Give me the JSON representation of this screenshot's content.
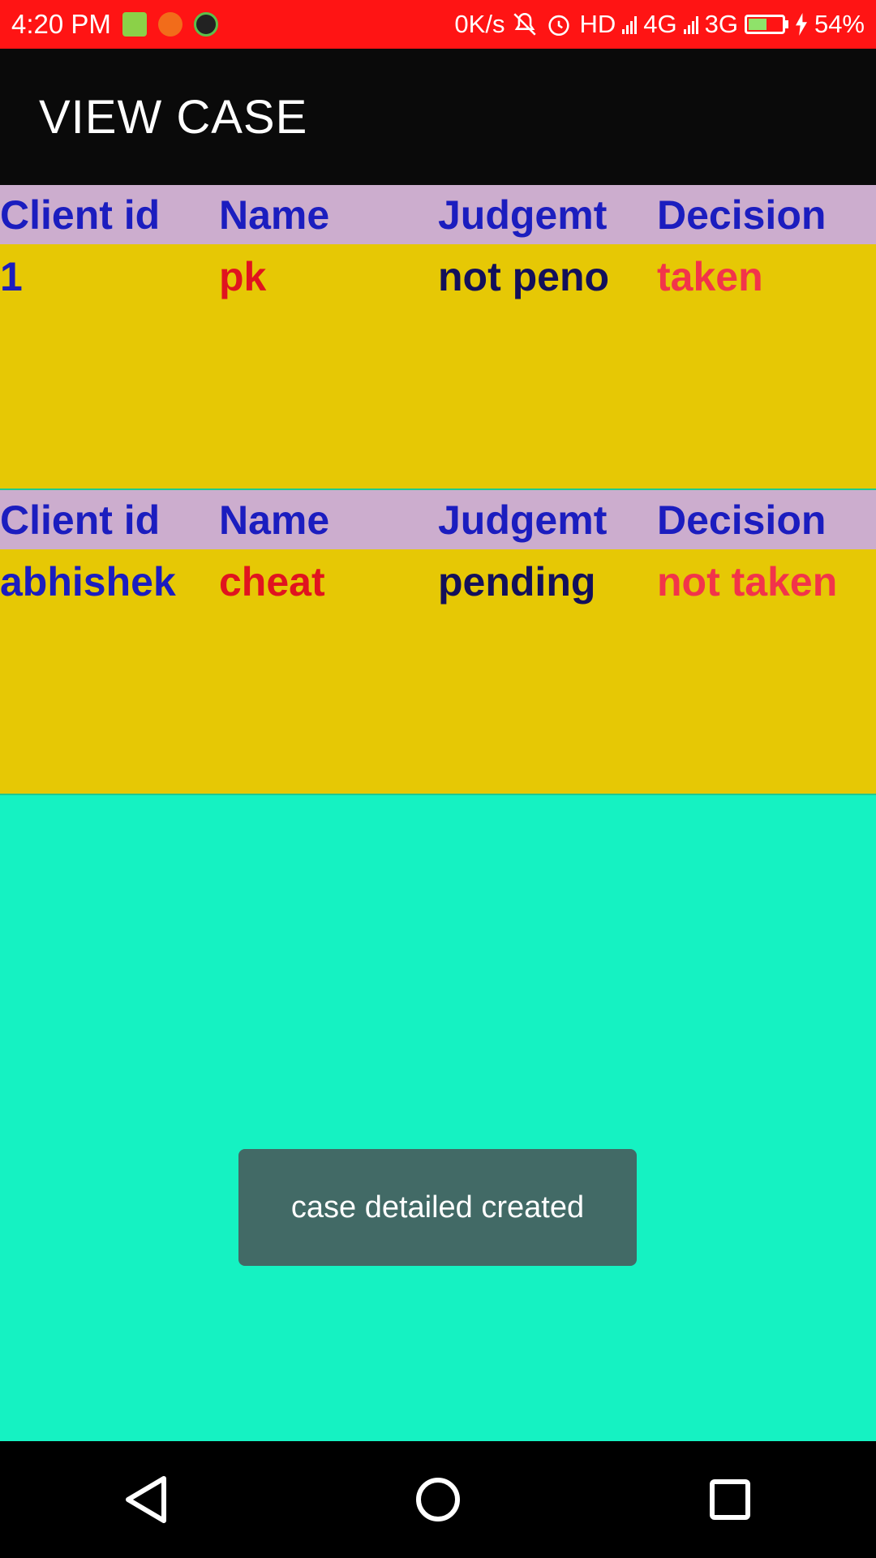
{
  "status_bar": {
    "time": "4:20 PM",
    "net_speed": "0K/s",
    "hd": "HD",
    "net1": "4G",
    "net2": "3G",
    "battery": "54%",
    "icons": [
      "notification-bag-icon",
      "crop-icon",
      "call-recorder-icon",
      "mute-icon",
      "alarm-icon",
      "signal-icon",
      "battery-icon",
      "charging-icon"
    ],
    "color": "#ff1414"
  },
  "app_bar": {
    "title": "VIEW CASE",
    "color": "#0a0a0a"
  },
  "columns": [
    "Client id",
    "Name",
    "Judgemt",
    "Decision"
  ],
  "cases": [
    {
      "client_id": "1",
      "name": "pk",
      "judgement": "not peno",
      "decision": "taken"
    },
    {
      "client_id": "abhishek",
      "name": "cheat",
      "judgement": "pending",
      "decision": "not taken"
    }
  ],
  "toast": {
    "message": "case detailed created"
  },
  "nav_bar": {
    "buttons": [
      "back-icon",
      "home-icon",
      "recents-icon"
    ]
  },
  "colors": {
    "background": "#15f2c2",
    "card": "#e6c805",
    "header_row": "#ccadce",
    "header_text": "#1b1dbf",
    "name_text": "#e0141f",
    "decision_text": "#f2344a"
  }
}
